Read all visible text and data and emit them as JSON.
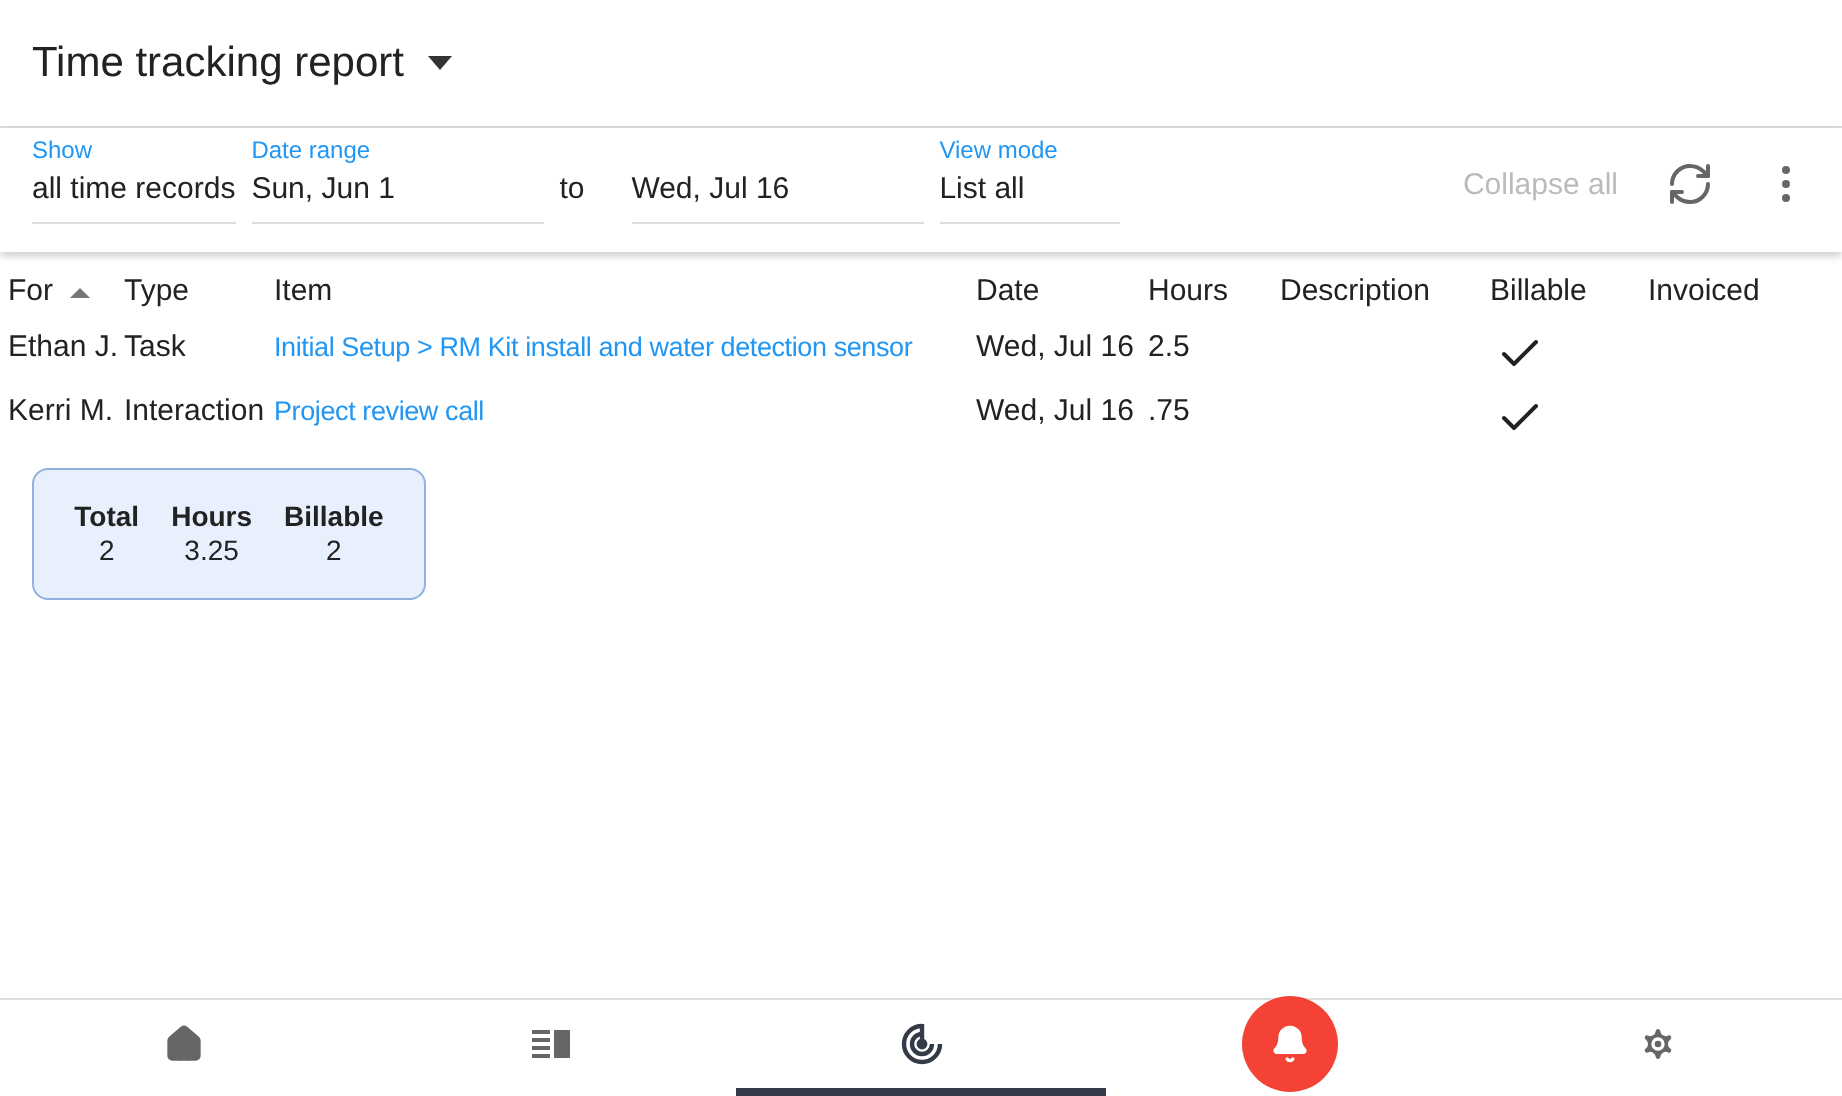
{
  "header": {
    "title": "Time tracking report"
  },
  "filters": {
    "show": {
      "label": "Show",
      "value": "all time records"
    },
    "date_range": {
      "label": "Date range",
      "from": "Sun, Jun 1",
      "separator": "to",
      "to": "Wed, Jul 16"
    },
    "view_mode": {
      "label": "View mode",
      "value": "List all"
    },
    "collapse_all": {
      "label": "Collapse all",
      "disabled": true
    }
  },
  "table": {
    "columns": [
      {
        "label": "For",
        "sorted": true
      },
      {
        "label": "Type",
        "sorted": false
      },
      {
        "label": "Item",
        "sorted": false
      },
      {
        "label": "Date",
        "sorted": false
      },
      {
        "label": "Hours",
        "sorted": false
      },
      {
        "label": "Description",
        "sorted": false
      },
      {
        "label": "Billable",
        "sorted": false
      },
      {
        "label": "Invoiced",
        "sorted": false
      }
    ],
    "rows": [
      {
        "for": "Ethan J.",
        "type": "Task",
        "item": "Initial Setup > RM Kit install and water detection sensor",
        "date": "Wed, Jul 16",
        "hours": "2.5",
        "billable": true,
        "invoiced": false
      },
      {
        "for": "Kerri M.",
        "type": "Interaction",
        "item": "Project review call",
        "date": "Wed, Jul 16",
        "hours": ".75",
        "billable": true,
        "invoiced": false
      }
    ]
  },
  "summary": [
    {
      "label": "Total",
      "value": "2"
    },
    {
      "label": "Hours",
      "value": "3.25"
    },
    {
      "label": "Billable",
      "value": "2"
    }
  ],
  "nav": [
    {
      "kind": "home",
      "selected": false
    },
    {
      "kind": "list",
      "selected": false
    },
    {
      "kind": "radar",
      "selected": true
    },
    {
      "kind": "alert",
      "selected": false
    },
    {
      "kind": "settings",
      "selected": false
    }
  ]
}
